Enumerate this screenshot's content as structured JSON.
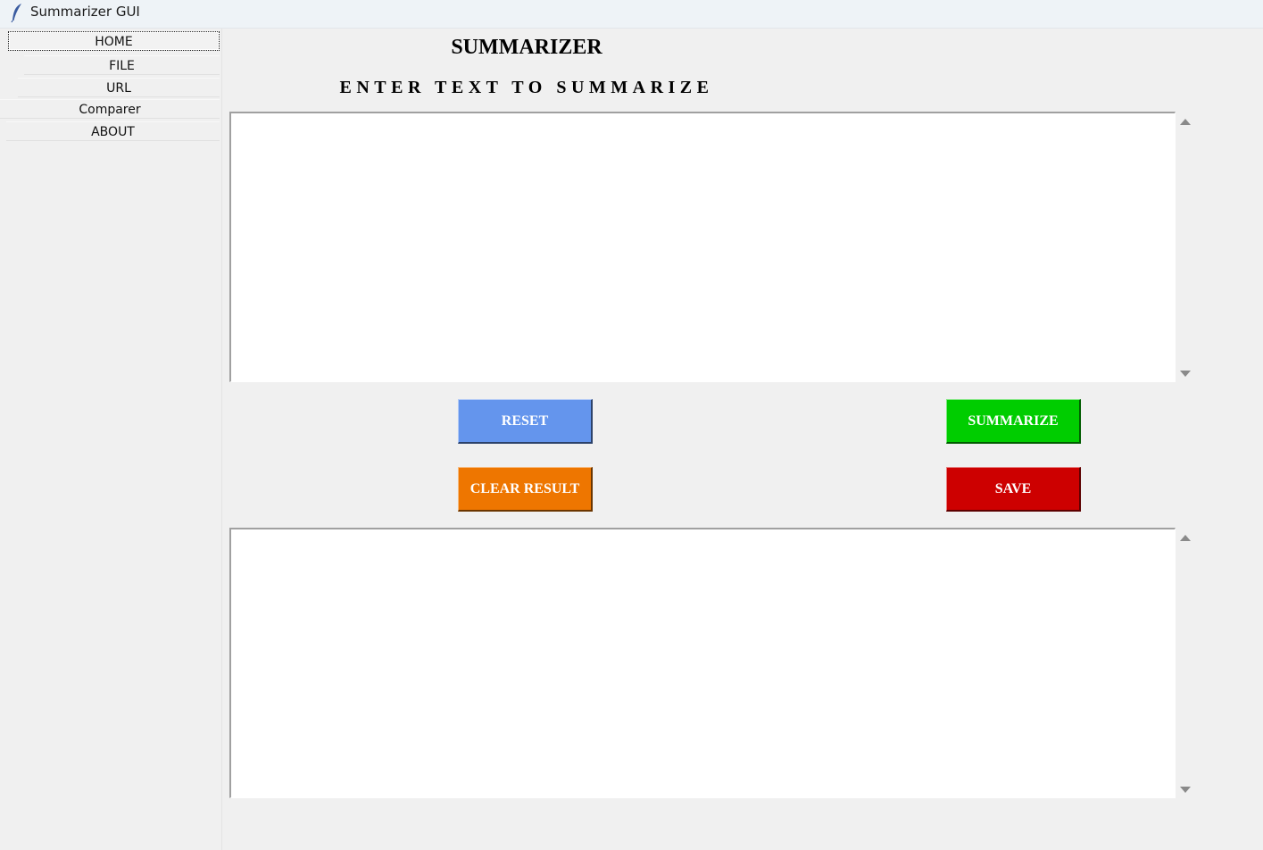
{
  "window": {
    "title": "Summarizer GUI",
    "icon": "feather-icon"
  },
  "sidebar": {
    "items": [
      {
        "label": "HOME",
        "active": true
      },
      {
        "label": "FILE",
        "active": false
      },
      {
        "label": "URL",
        "active": false
      },
      {
        "label": "Comparer",
        "active": false
      },
      {
        "label": "ABOUT",
        "active": false
      }
    ]
  },
  "main": {
    "title": "SUMMARIZER",
    "subtitle": "ENTER TEXT TO SUMMARIZE",
    "input_text": "",
    "result_text": ""
  },
  "buttons": {
    "reset": {
      "label": "RESET",
      "color": "#6495ed"
    },
    "summarize": {
      "label": "SUMMARIZE",
      "color": "#00cd00"
    },
    "clear_result": {
      "label": "CLEAR RESULT",
      "color": "#ee7600"
    },
    "save": {
      "label": "SAVE",
      "color": "#cd0000"
    }
  },
  "colors": {
    "background": "#f0f0f0",
    "textbox": "#ffffff",
    "titlebar": "#eef3f7"
  }
}
